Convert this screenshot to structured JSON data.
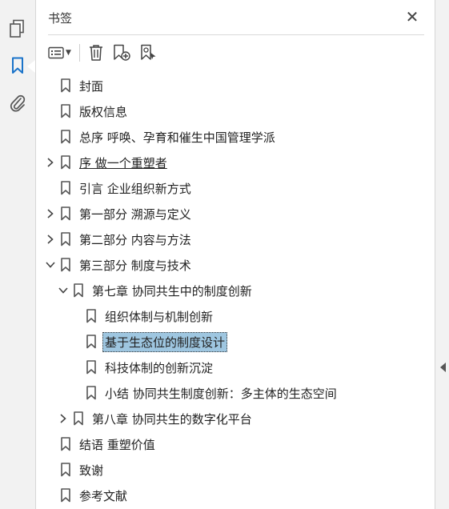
{
  "panel": {
    "title": "书签"
  },
  "rail": {
    "icons": [
      "pages-icon",
      "bookmarks-icon",
      "attachments-icon"
    ],
    "active": "bookmarks-icon",
    "accent": "#1a73c9"
  },
  "toolbar": {
    "buttons": [
      "options-menu-icon",
      "delete-bookmark-icon",
      "new-bookmark-icon",
      "find-bookmark-icon"
    ]
  },
  "bookmarks": [
    {
      "label": "封面",
      "expander": "none"
    },
    {
      "label": "版权信息",
      "expander": "none"
    },
    {
      "label": "总序 呼唤、孕育和催生中国管理学派",
      "expander": "none"
    },
    {
      "label": "序 做一个重塑者",
      "expander": "collapsed"
    },
    {
      "label": "引言 企业组织新方式",
      "expander": "none"
    },
    {
      "label": "第一部分 溯源与定义",
      "expander": "collapsed"
    },
    {
      "label": "第二部分 内容与方法",
      "expander": "collapsed"
    },
    {
      "label": "第三部分 制度与技术",
      "expander": "expanded"
    },
    {
      "label": "第七章 协同共生中的制度创新",
      "expander": "expanded"
    },
    {
      "label": "组织体制与机制创新",
      "expander": "none"
    },
    {
      "label": "基于生态位的制度设计",
      "expander": "none",
      "selected": true
    },
    {
      "label": "科技体制的创新沉淀",
      "expander": "none"
    },
    {
      "label": "小结 协同共生制度创新：多主体的生态空间",
      "expander": "none"
    },
    {
      "label": "第八章 协同共生的数字化平台",
      "expander": "collapsed"
    },
    {
      "label": "结语 重塑价值",
      "expander": "none"
    },
    {
      "label": "致谢",
      "expander": "none"
    },
    {
      "label": "参考文献",
      "expander": "none"
    }
  ],
  "colors": {
    "selection": "#9ec6e0",
    "rail_bg": "#f2f2f2"
  }
}
